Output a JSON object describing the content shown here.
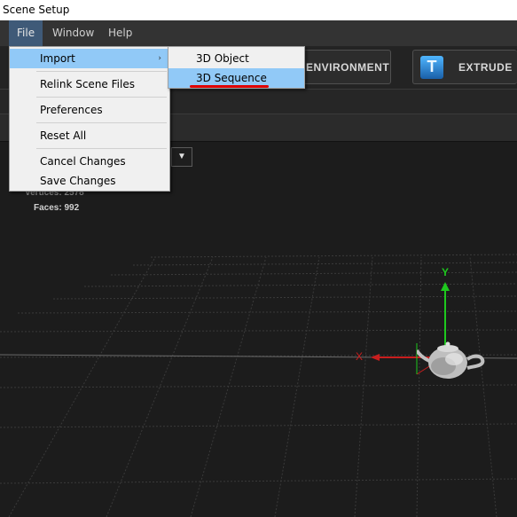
{
  "window": {
    "title": "Scene Setup"
  },
  "menubar": {
    "file": "File",
    "window": "Window",
    "help": "Help"
  },
  "toolbar": {
    "environment": "ENVIRONMENT",
    "extrude": "EXTRUDE",
    "extrude_icon_glyph": "T"
  },
  "file_menu": {
    "items": [
      "Import",
      "Relink Scene Files",
      "Preferences",
      "Reset All",
      "Cancel Changes",
      "Save Changes"
    ],
    "submenu_arrow": "›"
  },
  "import_submenu": {
    "items": [
      "3D Object",
      "3D Sequence"
    ]
  },
  "viewport": {
    "vertices_label": "Vertices: 2578",
    "faces_label": "Faces: 992",
    "axis_x": "X",
    "axis_y": "Y",
    "dropdown_glyph": "▼"
  },
  "colors": {
    "highlight": "#91c9f7",
    "underline": "#e00000",
    "axis_x": "#c81e1e",
    "axis_y": "#1ec81e",
    "menubar": "#333333"
  }
}
